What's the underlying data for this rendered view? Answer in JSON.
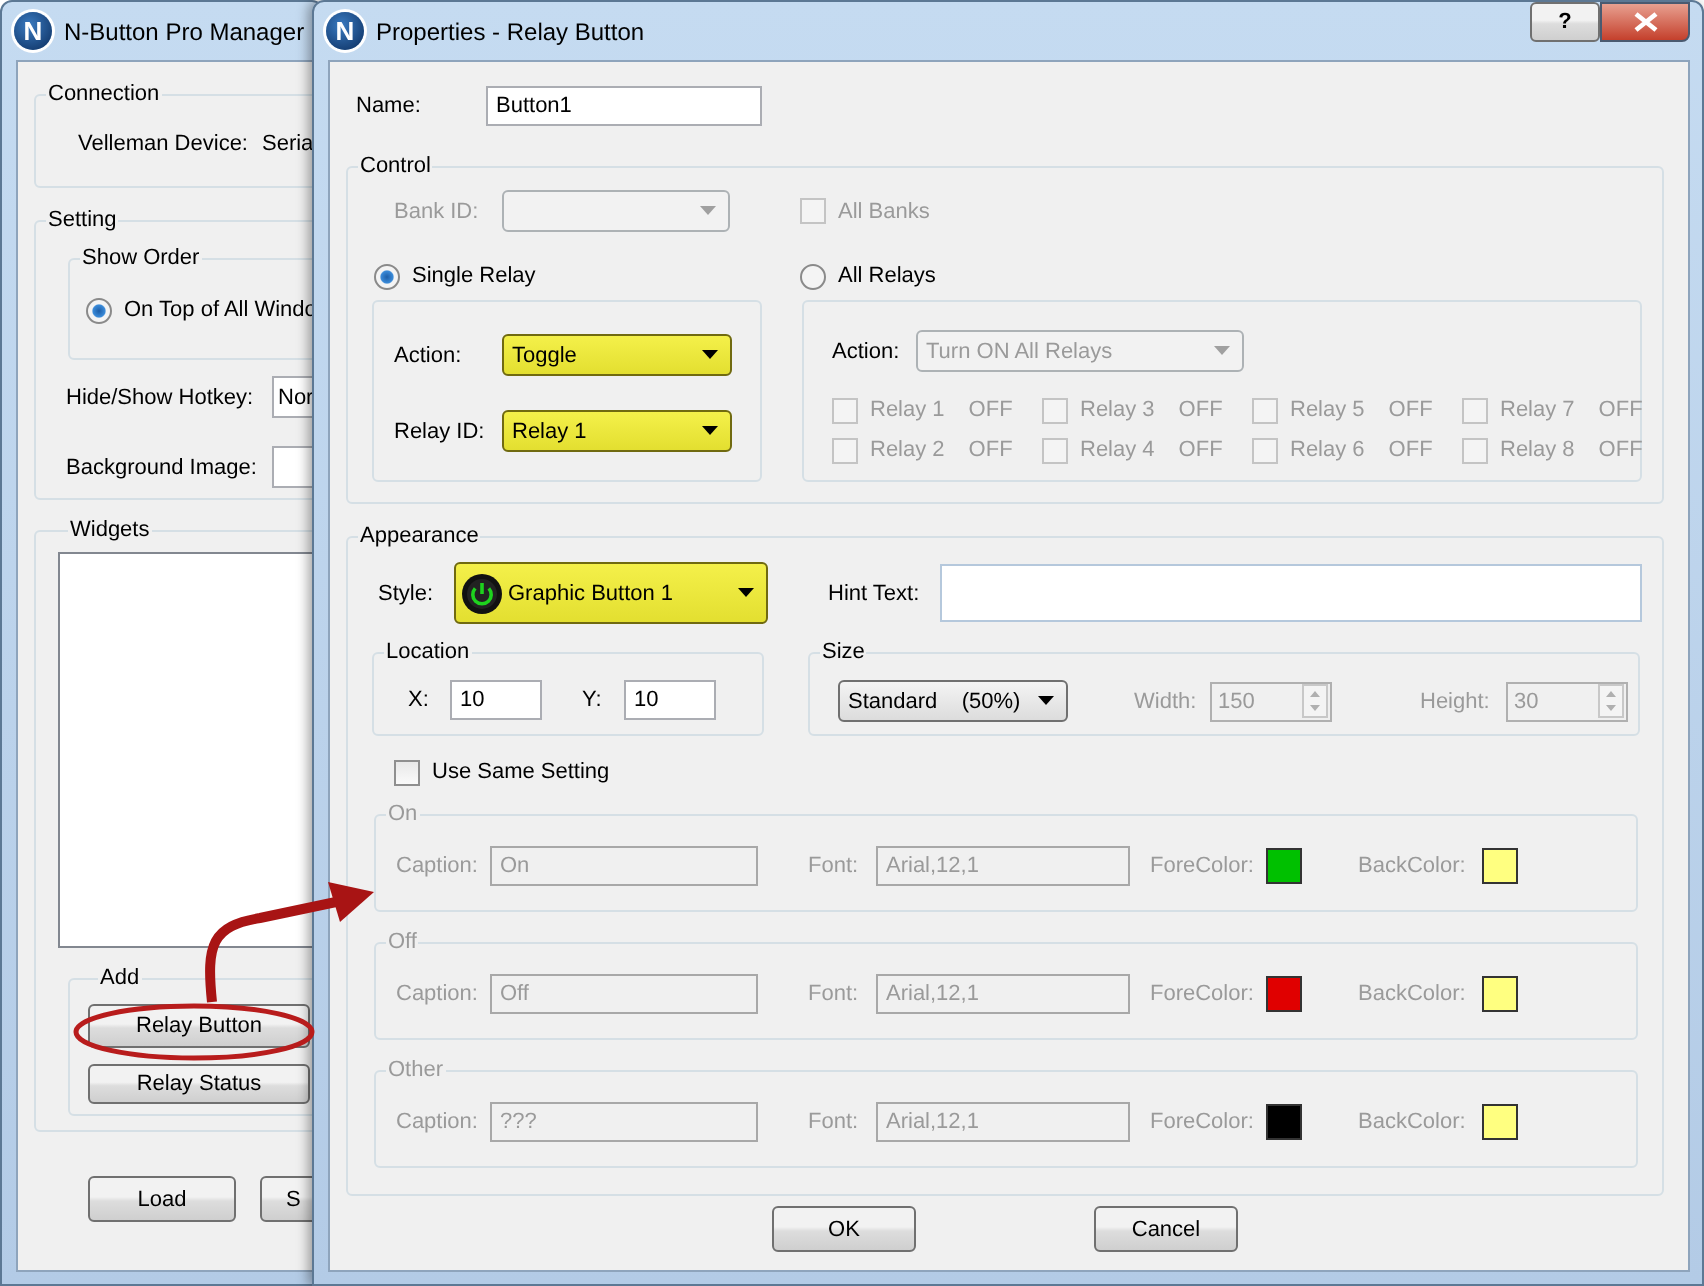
{
  "manager_window": {
    "logo_letter": "N",
    "title": "N-Button Pro Manager",
    "connection": {
      "label": "Connection",
      "device_label": "Velleman Device:",
      "device_value": "Seria"
    },
    "setting": {
      "label": "Setting",
      "show_order": {
        "label": "Show Order",
        "options": [
          {
            "label": "On Top of All Windo",
            "selected": true
          }
        ]
      },
      "hotkey": {
        "label": "Hide/Show Hotkey:",
        "value": "Nor"
      },
      "background_image": {
        "label": "Background Image:"
      }
    },
    "widgets": {
      "label": "Widgets"
    },
    "add": {
      "label": "Add",
      "buttons": [
        "Relay Button",
        "Relay Status"
      ]
    },
    "buttons": [
      "Load",
      "S"
    ]
  },
  "dialog": {
    "logo_letter": "N",
    "title": "Properties - Relay Button",
    "help": "?",
    "name": {
      "label": "Name:",
      "value": "Button1"
    },
    "control": {
      "label": "Control",
      "bank_id": {
        "label": "Bank ID:",
        "disabled": true
      },
      "all_banks": {
        "label": "All Banks",
        "checked": false,
        "disabled": true
      },
      "modes": [
        {
          "label": "Single Relay",
          "selected": true
        },
        {
          "label": "All Relays",
          "selected": false
        }
      ],
      "single": {
        "action": {
          "label": "Action:",
          "value": "Toggle",
          "highlighted": true
        },
        "relay_id": {
          "label": "Relay ID:",
          "value": "Relay 1",
          "highlighted": true
        }
      },
      "all": {
        "disabled": true,
        "action": {
          "label": "Action:",
          "value": "Turn ON All Relays"
        },
        "relays": [
          {
            "label": "Relay 1",
            "state": "OFF",
            "checked": false
          },
          {
            "label": "Relay 2",
            "state": "OFF",
            "checked": false
          },
          {
            "label": "Relay 3",
            "state": "OFF",
            "checked": false
          },
          {
            "label": "Relay 4",
            "state": "OFF",
            "checked": false
          },
          {
            "label": "Relay 5",
            "state": "OFF",
            "checked": false
          },
          {
            "label": "Relay 6",
            "state": "OFF",
            "checked": false
          },
          {
            "label": "Relay 7",
            "state": "OFF",
            "checked": false
          },
          {
            "label": "Relay 8",
            "state": "OFF",
            "checked": false
          }
        ]
      }
    },
    "appearance": {
      "label": "Appearance",
      "style": {
        "label": "Style:",
        "value": "Graphic Button 1",
        "highlighted": true
      },
      "hint": {
        "label": "Hint Text:"
      },
      "location": {
        "label": "Location",
        "x": {
          "label": "X:",
          "value": "10"
        },
        "y": {
          "label": "Y:",
          "value": "10"
        }
      },
      "size": {
        "label": "Size",
        "preset": "Standard    (50%)",
        "dims_disabled": true,
        "width": {
          "label": "Width:",
          "value": "150"
        },
        "height": {
          "label": "Height:",
          "value": "30"
        }
      },
      "same_setting": {
        "label": "Use Same Setting",
        "checked": false
      },
      "states_disabled": true,
      "states": [
        {
          "label": "On",
          "caption_label": "Caption:",
          "caption": "On",
          "font_label": "Font:",
          "font": "Arial,12,1",
          "fore": {
            "label": "ForeColor:",
            "color": "#00c000"
          },
          "back": {
            "label": "BackColor:",
            "color": "#ffff80"
          }
        },
        {
          "label": "Off",
          "caption_label": "Caption:",
          "caption": "Off",
          "font_label": "Font:",
          "font": "Arial,12,1",
          "fore": {
            "label": "ForeColor:",
            "color": "#e00000"
          },
          "back": {
            "label": "BackColor:",
            "color": "#ffff80"
          }
        },
        {
          "label": "Other",
          "caption_label": "Caption:",
          "caption": "???",
          "font_label": "Font:",
          "font": "Arial,12,1",
          "fore": {
            "label": "ForeColor:",
            "color": "#000000"
          },
          "back": {
            "label": "BackColor:",
            "color": "#ffff80"
          }
        }
      ]
    },
    "buttons": [
      "OK",
      "Cancel"
    ]
  }
}
